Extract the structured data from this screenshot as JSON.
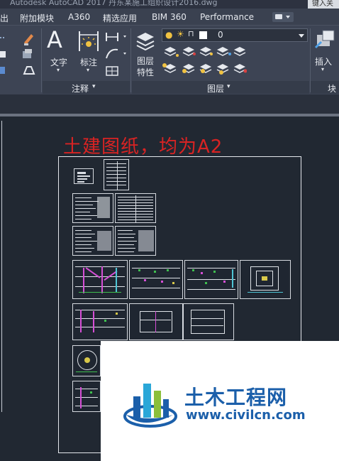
{
  "window": {
    "title": "Autodesk AutoCAD 2017    丹东某施工组织设计2016.dwg",
    "search_placeholder": "键入关"
  },
  "ribbon_tabs": [
    "出",
    "附加模块",
    "A360",
    "精选应用",
    "BIM 360",
    "Performance"
  ],
  "ribbon": {
    "text_button": "文字",
    "dimension_button": "标注",
    "annotation_panel": "注释",
    "layer_properties_button": "图层\n特性",
    "layer_value": "0",
    "layers_panel": "图层",
    "insert_button": "插入",
    "block_panel": "块"
  },
  "drawing": {
    "annotation": "土建图纸，均为A2"
  },
  "watermark": {
    "name": "土木工程网",
    "url": "www.civilcn.com"
  },
  "colors": {
    "annotation_red": "#d92323",
    "brand_blue": "#1b5faa",
    "canvas": "#212832"
  }
}
